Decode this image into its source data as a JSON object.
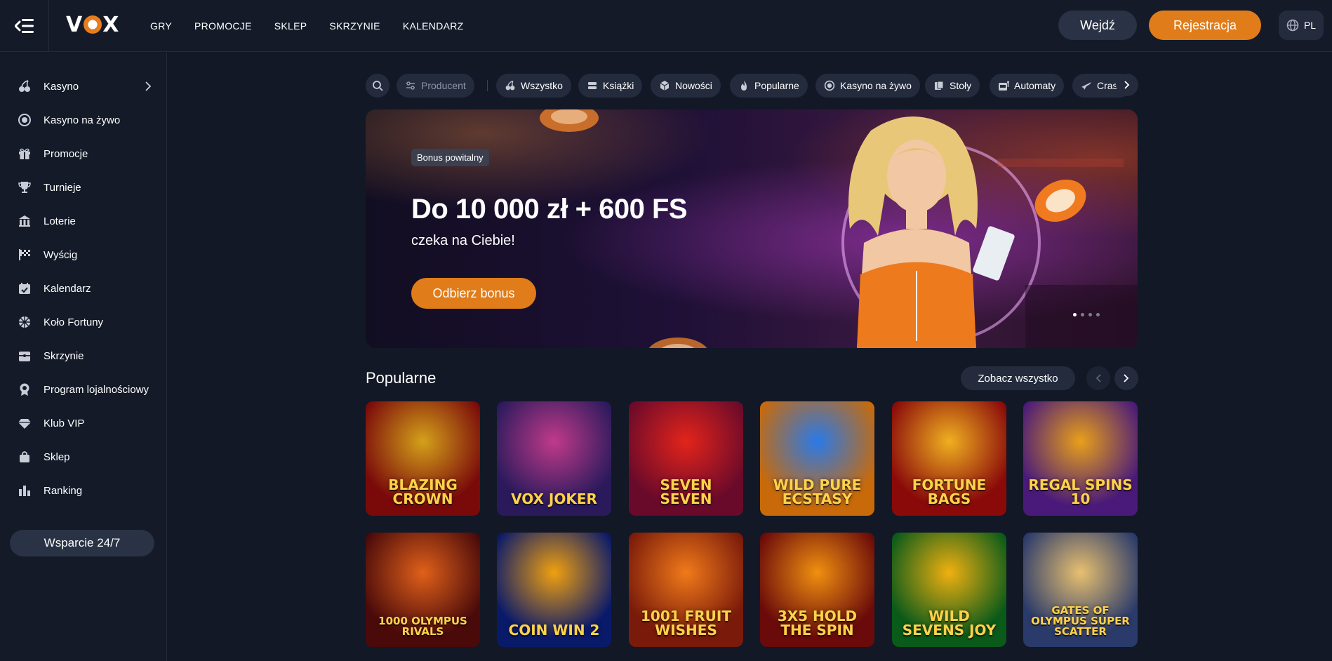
{
  "brand": {
    "logo_text_left": "V",
    "logo_text_right": "X"
  },
  "topnav": [
    "GRY",
    "PROMOCJE",
    "SKLEP",
    "SKRZYNIE",
    "KALENDARZ"
  ],
  "auth": {
    "login": "Wejdź",
    "register": "Rejestracja"
  },
  "language": "PL",
  "sidebar": {
    "items": [
      {
        "label": "Kasyno",
        "icon": "cherries-icon"
      },
      {
        "label": "Kasyno na żywo",
        "icon": "live-casino-icon"
      },
      {
        "label": "Promocje",
        "icon": "gift-icon"
      },
      {
        "label": "Turnieje",
        "icon": "trophy-icon"
      },
      {
        "label": "Loterie",
        "icon": "lottery-icon"
      },
      {
        "label": "Wyścig",
        "icon": "race-flag-icon"
      },
      {
        "label": "Kalendarz",
        "icon": "calendar-icon"
      },
      {
        "label": "Koło Fortuny",
        "icon": "wheel-icon"
      },
      {
        "label": "Skrzynie",
        "icon": "chest-icon"
      },
      {
        "label": "Program lojalnościowy",
        "icon": "loyalty-badge-icon"
      },
      {
        "label": "Klub VIP",
        "icon": "diamond-icon"
      },
      {
        "label": "Sklep",
        "icon": "shopping-bag-icon"
      },
      {
        "label": "Ranking",
        "icon": "ranking-bars-icon"
      }
    ],
    "support": "Wsparcie 24/7"
  },
  "filters": {
    "producer": "Producent",
    "chips": [
      "Wszystko",
      "Książki",
      "Nowości",
      "Popularne",
      "Kasyno na żywo",
      "Stoły",
      "Automaty",
      "Crash"
    ]
  },
  "banner": {
    "tag": "Bonus powitalny",
    "title": "Do 10 000 zł + 600 FS",
    "subtitle": "czeka na Ciebie!",
    "cta": "Odbierz bonus",
    "slides": 4,
    "active_slide": 1
  },
  "popular": {
    "title": "Popularne",
    "see_all": "Zobacz wszystko",
    "games": [
      {
        "name": "Blazing Crown",
        "colors": [
          "#7a0a0a",
          "#d4a11a"
        ]
      },
      {
        "name": "Vox Joker",
        "colors": [
          "#2a1a5c",
          "#c03a8a"
        ]
      },
      {
        "name": "Seven Seven",
        "colors": [
          "#6a0a2a",
          "#e3241b"
        ]
      },
      {
        "name": "Wild Pure Ecstasy",
        "colors": [
          "#c86a0a",
          "#2a7ae8"
        ]
      },
      {
        "name": "Fortune Bags",
        "colors": [
          "#8a0a0a",
          "#f0b020"
        ]
      },
      {
        "name": "Regal Spins 10",
        "colors": [
          "#4a1a7a",
          "#e8a01a"
        ]
      },
      {
        "name": "1000 Olympus Rivals",
        "colors": [
          "#4a0a0a",
          "#e0601a"
        ]
      },
      {
        "name": "Coin Win 2",
        "colors": [
          "#0a1a6a",
          "#f0a010"
        ]
      },
      {
        "name": "1001 Fruit Wishes",
        "colors": [
          "#7a1a0a",
          "#f07a1a"
        ]
      },
      {
        "name": "3x5 Hold The Spin",
        "colors": [
          "#6a0a0a",
          "#f09010"
        ]
      },
      {
        "name": "Wild Sevens Joy",
        "colors": [
          "#0a5a1a",
          "#f0b010"
        ]
      },
      {
        "name": "Gates of Olympus Super Scatter",
        "colors": [
          "#2a3a6a",
          "#e8c070"
        ]
      }
    ]
  }
}
